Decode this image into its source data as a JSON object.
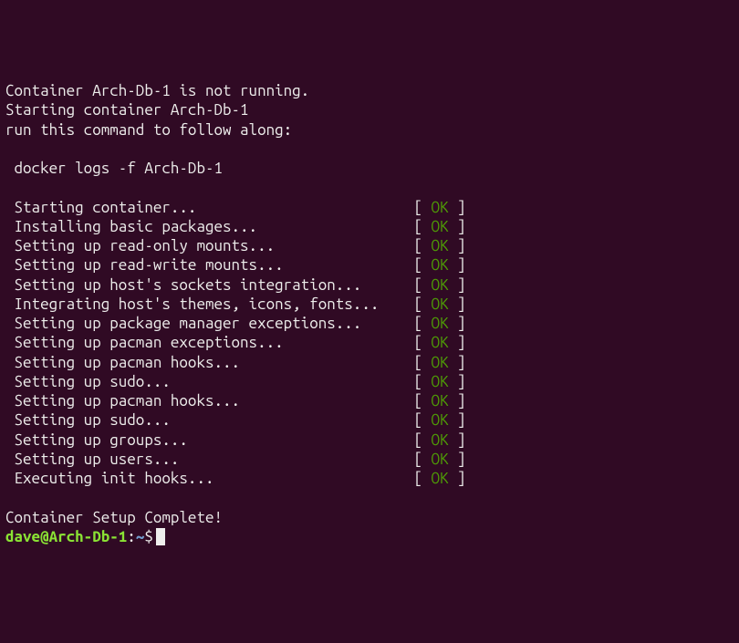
{
  "intro": [
    "Container Arch-Db-1 is not running.",
    "Starting container Arch-Db-1",
    "run this command to follow along:",
    "",
    " docker logs -f Arch-Db-1",
    ""
  ],
  "status_ok": "OK",
  "tasks": [
    " Starting container...",
    " Installing basic packages...",
    " Setting up read-only mounts...",
    " Setting up read-write mounts...",
    " Setting up host's sockets integration...",
    " Integrating host's themes, icons, fonts...",
    " Setting up package manager exceptions...",
    " Setting up pacman exceptions...",
    " Setting up pacman hooks...",
    " Setting up sudo...",
    " Setting up pacman hooks...",
    " Setting up sudo...",
    " Setting up groups...",
    " Setting up users...",
    " Executing init hooks..."
  ],
  "outro": [
    "",
    "Container Setup Complete!"
  ],
  "prompt": {
    "user_host": "dave@Arch-Db-1",
    "sep": ":",
    "path": "~",
    "dollar": "$"
  }
}
